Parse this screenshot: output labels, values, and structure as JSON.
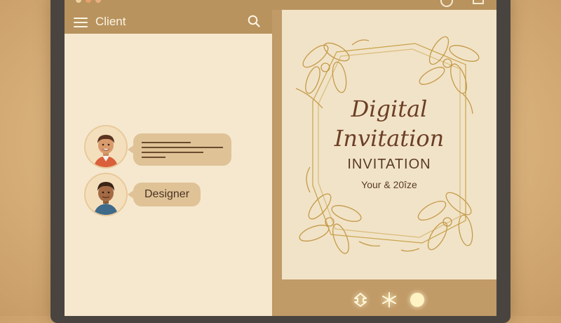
{
  "chat": {
    "header_title": "Client",
    "designer_label": "Designer"
  },
  "invitation": {
    "title_line1": "Digital",
    "title_line2": "Invitation",
    "subtitle": "INVITATION",
    "tagline": "Your & 20îze"
  },
  "icons": {
    "menu": "hamburger-menu-icon",
    "search": "search-icon",
    "action1": "share-icon",
    "action2": "star-icon",
    "action3": "circle-icon"
  },
  "colors": {
    "header": "#b8935e",
    "chat_bg": "#f5e8cf",
    "bubble": "#dfc296",
    "title_brown": "#6b3f26",
    "gold": "#c9a24a"
  }
}
